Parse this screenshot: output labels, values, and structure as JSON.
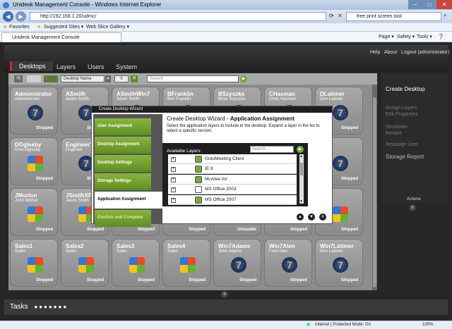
{
  "browser": {
    "title": "Unidesk Management Console - Windows Internet Explorer",
    "url": "http://192.168.1.20/udmc/",
    "search_text": "free print screen tool",
    "favorites_label": "Favorites",
    "suggested_sites": "Suggested Sites ▾",
    "web_slice": "Web Slice Gallery ▾",
    "tab_label": "Unidesk Management Console",
    "menu_page": "Page ▾",
    "menu_safety": "Safety ▾",
    "menu_tools": "Tools ▾",
    "status_zone": "Internet | Protected Mode: On",
    "zoom": "100%"
  },
  "app": {
    "tabs": [
      "Desktops",
      "Layers",
      "Users",
      "System"
    ],
    "links": [
      "Help",
      "About",
      "Logout (administrator)"
    ],
    "sort_select": "Desktop Name",
    "counter": "0",
    "search_placeholder": "Search",
    "tasks_label": "Tasks",
    "actions_label": "Actions",
    "side_items": [
      "Create Desktop",
      "Assign Layers",
      "Edit Properties",
      "Shutdown",
      "Restart",
      "Reassign User",
      "Storage Report"
    ]
  },
  "desktops": [
    {
      "name": "Administrator",
      "sub": "Administrator",
      "status": "Stopped",
      "os": "7"
    },
    {
      "name": "ASmith",
      "sub": "Adam Smith",
      "status": "Stopped",
      "os": "7"
    },
    {
      "name": "ASmithWin7",
      "sub": "Adam Smith",
      "status": "Stopped",
      "os": "7"
    },
    {
      "name": "BFranklin",
      "sub": "Ben Franklin",
      "status": "Stopped",
      "os": "7"
    },
    {
      "name": "BSzyszka",
      "sub": "Brian Szyszka",
      "status": "Stopped",
      "os": "7"
    },
    {
      "name": "CHasman",
      "sub": "Chris Hasman",
      "status": "Stopped",
      "os": "7"
    },
    {
      "name": "DLatimer",
      "sub": "Don Latimer",
      "status": "Stopped",
      "os": "7"
    },
    {
      "name": "DOglesby",
      "sub": "Dina Oglesby",
      "status": "Stopped",
      "os": "xp"
    },
    {
      "name": "Engineer1",
      "sub": "Engineer",
      "status": "Stopped",
      "os": "7"
    },
    {
      "name": "",
      "sub": "",
      "status": "Stopped",
      "os": "xp"
    },
    {
      "name": "",
      "sub": "",
      "status": "Stopped",
      "os": "xp"
    },
    {
      "name": "",
      "sub": "",
      "status": "Stopped",
      "os": "xp"
    },
    {
      "name": "",
      "sub": "",
      "status": "Stopped",
      "os": "xp"
    },
    {
      "name": "",
      "sub": "",
      "status": "Stopped",
      "os": "7"
    },
    {
      "name": "JMorton",
      "sub": "John Morton",
      "status": "Stopped",
      "os": "xp"
    },
    {
      "name": "JSmithXP",
      "sub": "Jason Smith",
      "status": "Stopped",
      "os": "xp"
    },
    {
      "name": "",
      "sub": "",
      "status": "Stopped",
      "os": "xp"
    },
    {
      "name": "",
      "sub": "",
      "status": "Stopped",
      "os": "xp"
    },
    {
      "name": "",
      "sub": "",
      "status": "Unusable",
      "os": "xp"
    },
    {
      "name": "",
      "sub": "",
      "status": "Stopped",
      "os": "xp"
    },
    {
      "name": "",
      "sub": "",
      "status": "Stopped",
      "os": "xp"
    },
    {
      "name": "Sales1",
      "sub": "Sales",
      "status": "Stopped",
      "os": "xp"
    },
    {
      "name": "Sales2",
      "sub": "Sales",
      "status": "Stopped",
      "os": "xp"
    },
    {
      "name": "Sales3",
      "sub": "Sales",
      "status": "Stopped",
      "os": "xp"
    },
    {
      "name": "Sales4",
      "sub": "Sales",
      "status": "Stopped",
      "os": "xp"
    },
    {
      "name": "Win7Adams",
      "sub": "John Adams",
      "status": "Stopped",
      "os": "7"
    },
    {
      "name": "Win7Aten",
      "sub": "Fred Aten",
      "status": "Stopped",
      "os": "7"
    },
    {
      "name": "Win7Latimer",
      "sub": "Don Latimer",
      "status": "Stopped",
      "os": "7"
    }
  ],
  "wizard": {
    "window_title": "Create Desktop Wizard",
    "heading_prefix": "Create Desktop Wizard - ",
    "heading_bold": "Application Assignment",
    "description": "Select the application layers to include in the desktop. Expand a layer in the list to select a specific version.",
    "steps": [
      "User Assignment",
      "Desktop Assignment",
      "Desktop Settings",
      "Storage Settings",
      "Application Assignment",
      "Confirm and Complete"
    ],
    "layers_header": "Available Layers",
    "search_placeholder": "Search",
    "layers": [
      {
        "name": "GotoMeeting Client",
        "checked": true
      },
      {
        "name": "IE 8",
        "checked": true
      },
      {
        "name": "McAfee AV",
        "checked": true
      },
      {
        "name": "MS Office 2003",
        "checked": false
      },
      {
        "name": "MS Office 2007",
        "checked": true
      }
    ]
  }
}
